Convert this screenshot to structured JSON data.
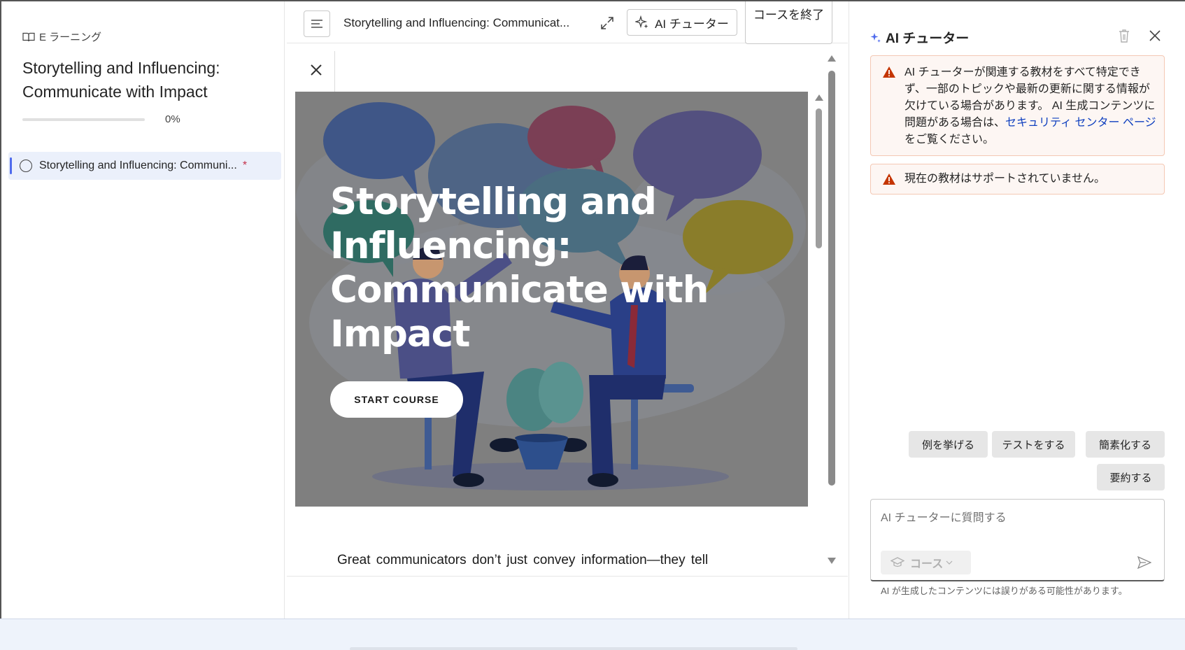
{
  "sidebar": {
    "breadcrumb": "E ラーニング",
    "title": "Storytelling and Influencing: Communicate with Impact",
    "progress_fraction": 0,
    "progress_text": "0%",
    "items": [
      {
        "label": "Storytelling and Influencing: Communi...",
        "required_mark": "*"
      }
    ]
  },
  "toolbar": {
    "title": "Storytelling and Influencing: Communicat...",
    "ai_tutor_label": "AI チューター",
    "exit_label": "コースを終了"
  },
  "viewer": {
    "hero_title": "Storytelling and Influencing: Communicate with Impact",
    "start_label": "START COURSE",
    "body_text": "Great communicators don’t just convey information—they tell"
  },
  "panel": {
    "title": "AI チューター",
    "notice1": {
      "text_before": "AI チューターが関連する教材をすべて特定できず、一部のトピックや最新の更新に関する情報が欠けている場合があります。 AI 生成コンテンツに問題がある場合は、",
      "link": "セキュリティ センター ページ",
      "text_after": " をご覧ください。"
    },
    "notice2": "現在の教材はサポートされていません。",
    "chips": [
      "例を挙げる",
      "テストをする",
      "簡素化する",
      "要約する"
    ],
    "input_placeholder": "AI チューターに質問する",
    "course_select": "コース",
    "disclaimer": "AI が生成したコンテンツには誤りがある可能性があります。"
  },
  "colors": {
    "accent": "#4f6bed",
    "warning": "#c43501",
    "link": "#0f3fbf",
    "hero_overlay": "#7f7f7f"
  }
}
